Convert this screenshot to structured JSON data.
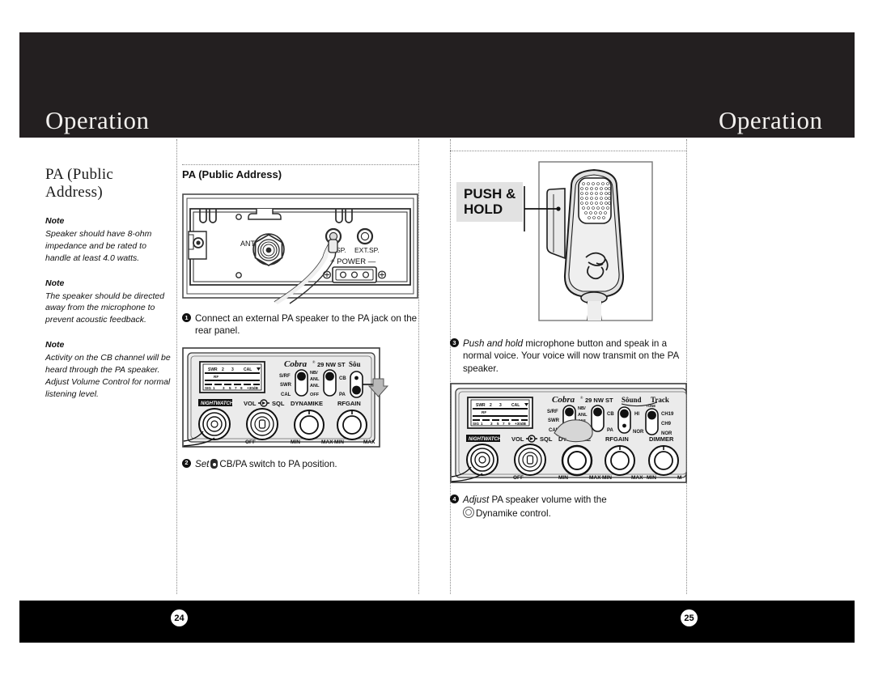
{
  "header": {
    "left_title": "Operation",
    "right_title": "Operation"
  },
  "footer": {
    "left_page": "24",
    "right_page": "25"
  },
  "margin": {
    "section_title": "PA (Public Address)",
    "notes": [
      {
        "label": "Note",
        "text": "Speaker should have 8-ohm impedance and be rated to handle at least 4.0 watts."
      },
      {
        "label": "Note",
        "text": "The speaker should be directed away from the microphone to prevent acoustic feedback."
      },
      {
        "label": "Note",
        "text": "Activity on the CB channel will be heard through the PA speaker. Adjust Volume Control for normal listening level."
      }
    ]
  },
  "left_column": {
    "subheading": "PA (Public Address)",
    "rear_panel": {
      "labels": {
        "ant": "ANT",
        "sp": "SP.",
        "ext_sp": "EXT.SP.",
        "power": "POWER"
      },
      "power_prefix": "+",
      "power_suffix": "—"
    },
    "step1": {
      "number": "1",
      "text": "Connect an external PA speaker to the PA jack on the rear panel."
    },
    "step2": {
      "number": "2",
      "lead": "Set",
      "text": "CB/PA switch to PA position."
    }
  },
  "right_column": {
    "callout": {
      "line1": "PUSH &",
      "line2": "HOLD"
    },
    "step3": {
      "number": "3",
      "lead": "Push and hold",
      "text": "microphone button and speak in a normal voice. Your voice will now transmit on the PA speaker."
    },
    "step4": {
      "number": "4",
      "lead": "Adjust",
      "text": "PA speaker volume with the",
      "text2": "Dynamike control."
    }
  },
  "faceplate": {
    "brand": "Cobra",
    "brand_reg": "®",
    "model": "29 NW ST",
    "sub_brand": "SOUNDTRACKER",
    "meter": {
      "top_scale": [
        "SWR",
        "2",
        "3",
        "CAL"
      ],
      "mid_label": "RF",
      "bottom_scale": [
        "SIG",
        "1",
        "3",
        "5",
        "7",
        "9",
        "+30dB"
      ]
    },
    "switch1": {
      "top": "S/RF",
      "mid": "SWR",
      "bottom": "CAL"
    },
    "switch2": {
      "top": "NB/",
      "mid": "ANL",
      "mid2": "ANL",
      "bottom": "OFF"
    },
    "switch3": {
      "top": "CB",
      "bottom": "PA"
    },
    "switch4": {
      "top": "HI",
      "bottom": "NOR",
      "tone": "TONE"
    },
    "switch5": {
      "top": "CH19",
      "mid": "CH9",
      "bottom": "NOR"
    },
    "knobs": [
      {
        "label": "VOL",
        "label2": "SQL",
        "min": "OFF",
        "max": ""
      },
      {
        "label": "DYNAMIKE",
        "min": "MIN",
        "max": "MAX"
      },
      {
        "label": "RFGAIN",
        "min": "MIN",
        "max": "MAX"
      },
      {
        "label": "DIMMER",
        "min": "MIN",
        "max": "M"
      }
    ],
    "nightwatch": "NiGHTWATCH"
  },
  "colors": {
    "header_bar": "#231f20",
    "footer_bar": "#000000",
    "page_bg": "#ffffff",
    "callout_bg": "#e2e2e2",
    "panel_face": "#e8e8e8",
    "ink": "#111111",
    "rule": "#8a8a8a"
  }
}
